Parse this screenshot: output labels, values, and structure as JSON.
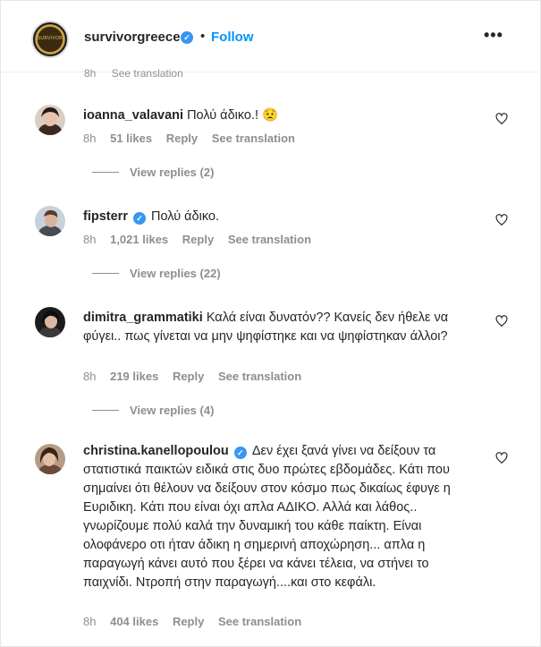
{
  "header": {
    "username": "survivorgreece",
    "separator": "•",
    "follow_label": "Follow",
    "more_label": "•••",
    "avatar_text": "SURVIVOR"
  },
  "meta_top": {
    "time": "8h",
    "translation": "See translation"
  },
  "comments": [
    {
      "username": "ioanna_valavani",
      "verified": false,
      "text": "Πολύ άδικο.! 😟",
      "time": "8h",
      "likes": "51 likes",
      "reply": "Reply",
      "translation": "See translation",
      "view_replies": "View replies (2)"
    },
    {
      "username": "fipsterr",
      "verified": true,
      "text": "Πολύ άδικο.",
      "time": "8h",
      "likes": "1,021 likes",
      "reply": "Reply",
      "translation": "See translation",
      "view_replies": "View replies (22)"
    },
    {
      "username": "dimitra_grammatiki",
      "verified": false,
      "text": "Καλά είναι δυνατόν?? Κανείς δεν ήθελε να φύγει.. πως γίνεται να μην ψηφίστηκε και να ψηφίστηκαν άλλοι?",
      "time": "8h",
      "likes": "219 likes",
      "reply": "Reply",
      "translation": "See translation",
      "view_replies": "View replies (4)"
    },
    {
      "username": "christina.kanellopoulou",
      "verified": true,
      "text": "Δεν έχει ξανά γίνει να δείξουν τα στατιστικά παικτών ειδικά στις δυο πρώτες εβδομάδες. Κάτι που σημαίνει ότι θέλουν να δείξουν στον κόσμο πως δικαίως έφυγε η Ευριδικη. Κάτι που είναι όχι απλα ΑΔΙΚΟ. Αλλά και λάθος.. γνωρίζουμε πολύ καλά την δυναμική του κάθε παίκτη. Είναι ολοφάνερο οτι ήταν άδικη η σημερινή αποχώρηση... απλα η παραγωγή κάνει αυτό που ξέρει να κάνει τέλεια, να στήνει το παιχνίδι. Ντροπή στην παραγωγή....και στο κεφάλι.",
      "time": "8h",
      "likes": "404 likes",
      "reply": "Reply",
      "translation": "See translation"
    }
  ],
  "colors": {
    "link": "#0095f6",
    "verified": "#3897f0",
    "muted": "#8e8e8e",
    "text": "#262626"
  }
}
